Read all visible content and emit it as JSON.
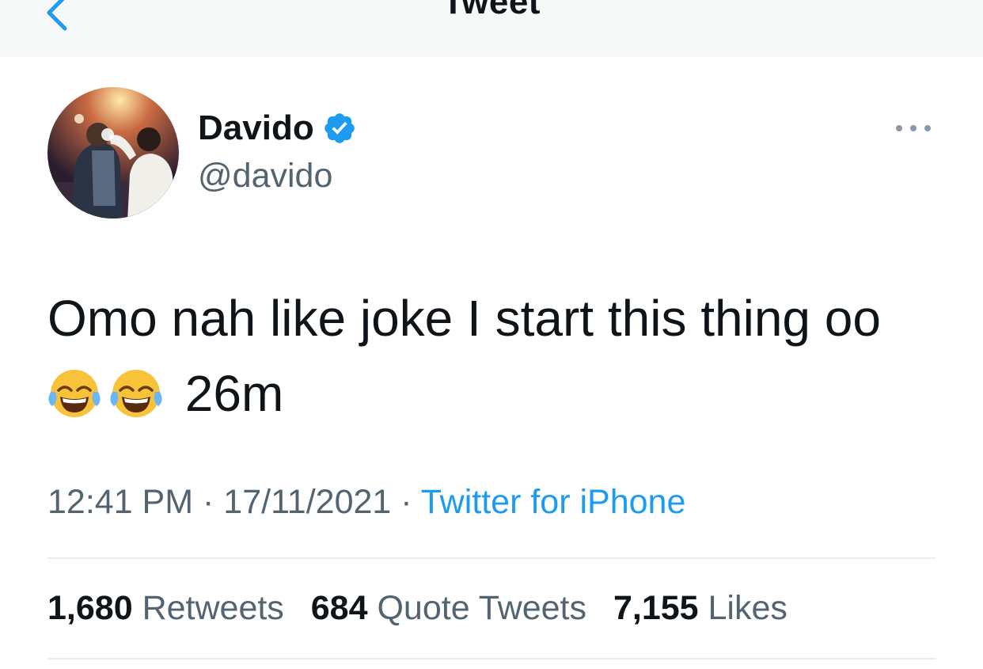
{
  "header": {
    "title": "Tweet",
    "back_icon": "chevron-left-icon"
  },
  "author": {
    "display_name": "Davido",
    "username": "@davido",
    "verified": true,
    "verified_icon": "verified-badge-icon",
    "avatar": "avatar-photo"
  },
  "more_icon": "more-dots-icon",
  "tweet": {
    "text": "Omo nah like joke I start this thing oo",
    "emojis": [
      "face-with-tears-of-joy",
      "face-with-tears-of-joy"
    ],
    "trailing_text": "26m"
  },
  "meta": {
    "time": "12:41 PM",
    "separator": "·",
    "date": "17/11/2021",
    "source": "Twitter for iPhone"
  },
  "stats": {
    "retweets_count": "1,680",
    "retweets_label": "Retweets",
    "quotes_count": "684",
    "quotes_label": "Quote Tweets",
    "likes_count": "7,155",
    "likes_label": "Likes"
  },
  "colors": {
    "accent": "#1d9bf0",
    "text_primary": "#0f1419",
    "text_secondary": "#536471",
    "divider": "#e6ecf0"
  }
}
